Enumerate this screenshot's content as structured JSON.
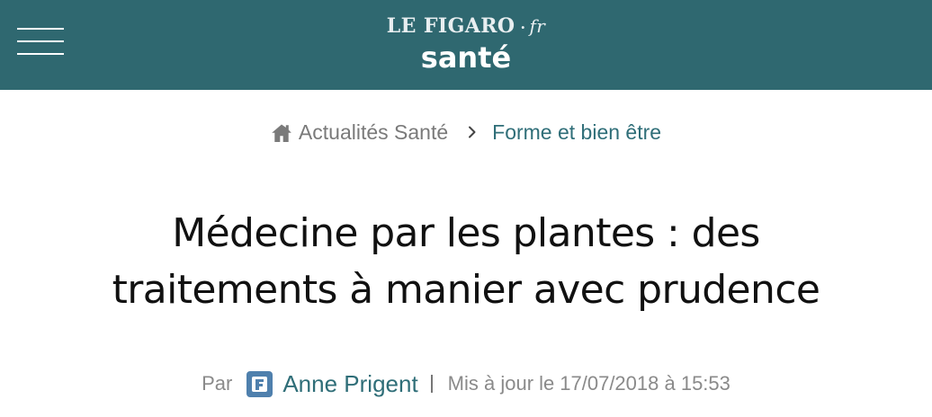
{
  "header": {
    "brand": {
      "name": "LE FIGARO",
      "separator": "·",
      "suffix": "fr",
      "section": "santé"
    },
    "colors": {
      "background": "#2f6870",
      "text": "#ffffff"
    },
    "menu_icon": "hamburger-menu-icon"
  },
  "breadcrumb": {
    "home_label": "Actualités Santé",
    "home_icon": "home-icon",
    "separator_icon": "chevron-right-icon",
    "current_label": "Forme et bien être",
    "colors": {
      "home": "#7a7a7a",
      "current": "#2f6e78"
    }
  },
  "article": {
    "title_line_1": "Médecine par les plantes : des",
    "title_line_2": "traitements à manier avec prudence"
  },
  "byline": {
    "by_label": "Par",
    "author_icon": "figaro-f-icon",
    "author_name": "Anne Prigent",
    "update_label": "Mis à jour le",
    "updated_at": "17/07/2018 à 15:53",
    "colors": {
      "meta": "#8a8a8a",
      "author": "#2f6e78",
      "badge": "#4f80ad"
    }
  }
}
